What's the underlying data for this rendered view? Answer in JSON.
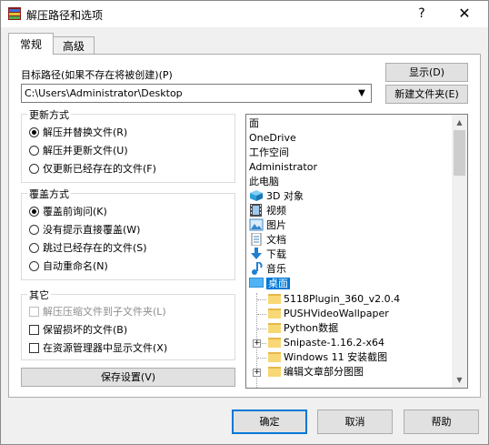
{
  "window": {
    "title": "解压路径和选项",
    "help_glyph": "?",
    "close_glyph": "✕"
  },
  "tabs": [
    {
      "label": "常规"
    },
    {
      "label": "高级"
    }
  ],
  "target": {
    "label": "目标路径(如果不存在将被创建)(P)",
    "value": "C:\\Users\\Administrator\\Desktop",
    "show_button": "显示(D)",
    "new_folder_button": "新建文件夹(E)"
  },
  "update_mode": {
    "title": "更新方式",
    "options": [
      {
        "label": "解压并替换文件(R)",
        "selected": true
      },
      {
        "label": "解压并更新文件(U)",
        "selected": false
      },
      {
        "label": "仅更新已经存在的文件(F)",
        "selected": false
      }
    ]
  },
  "overwrite_mode": {
    "title": "覆盖方式",
    "options": [
      {
        "label": "覆盖前询问(K)",
        "selected": true
      },
      {
        "label": "没有提示直接覆盖(W)",
        "selected": false
      },
      {
        "label": "跳过已经存在的文件(S)",
        "selected": false
      },
      {
        "label": "自动重命名(N)",
        "selected": false
      }
    ]
  },
  "misc": {
    "title": "其它",
    "options": [
      {
        "label": "解压压缩文件到子文件夹(L)",
        "checked": false,
        "disabled": true
      },
      {
        "label": "保留损坏的文件(B)",
        "checked": false,
        "disabled": false
      },
      {
        "label": "在资源管理器中显示文件(X)",
        "checked": false,
        "disabled": false
      }
    ]
  },
  "save_settings_button": "保存设置(V)",
  "tree": {
    "items": [
      {
        "label": "面",
        "icon": "none"
      },
      {
        "label": "OneDrive",
        "icon": "none"
      },
      {
        "label": "工作空间",
        "icon": "none"
      },
      {
        "label": "Administrator",
        "icon": "none"
      },
      {
        "label": "此电脑",
        "icon": "none"
      },
      {
        "label": "3D 对象",
        "icon": "3d-objects-icon"
      },
      {
        "label": "视频",
        "icon": "video-icon"
      },
      {
        "label": "图片",
        "icon": "pictures-icon"
      },
      {
        "label": "文档",
        "icon": "documents-icon"
      },
      {
        "label": "下载",
        "icon": "download-icon"
      },
      {
        "label": "音乐",
        "icon": "music-icon"
      },
      {
        "label": "桌面",
        "icon": "desktop-icon",
        "selected": true
      },
      {
        "label": "5118Plugin_360_v2.0.4",
        "icon": "folder-icon"
      },
      {
        "label": "PUSHVideoWallpaper",
        "icon": "folder-icon"
      },
      {
        "label": "Python数据",
        "icon": "folder-icon"
      },
      {
        "label": "Snipaste-1.16.2-x64",
        "icon": "folder-icon",
        "expandable": true
      },
      {
        "label": "Windows 11 安装截图",
        "icon": "folder-icon"
      },
      {
        "label": "编辑文章部分图图",
        "icon": "folder-icon",
        "expandable": true
      }
    ],
    "expander_glyph": "+"
  },
  "footer": {
    "ok": "确定",
    "cancel": "取消",
    "help": "帮助"
  },
  "colors": {
    "selection": "#0078d7",
    "accent_border": "#0078d7"
  }
}
